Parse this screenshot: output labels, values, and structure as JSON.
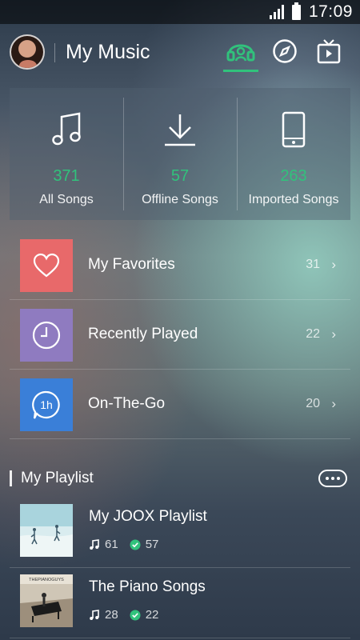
{
  "status_bar": {
    "time": "17:09",
    "signal_icon": "signal-icon",
    "battery_icon": "battery-icon"
  },
  "header": {
    "title": "My Music",
    "avatar": "avatar",
    "tabs": [
      {
        "icon": "headphones-icon",
        "active": true
      },
      {
        "icon": "compass-icon",
        "active": false
      },
      {
        "icon": "tv-icon",
        "active": false
      }
    ],
    "accent_color": "#31c27c"
  },
  "stats": [
    {
      "icon": "music-note-icon",
      "count": "371",
      "label": "All Songs"
    },
    {
      "icon": "download-icon",
      "count": "57",
      "label": "Offline Songs"
    },
    {
      "icon": "phone-icon",
      "count": "263",
      "label": "Imported Songs"
    }
  ],
  "lists": [
    {
      "icon": "heart-icon",
      "label": "My Favorites",
      "count": "31",
      "color": "#e8696a"
    },
    {
      "icon": "clock-icon",
      "label": "Recently Played",
      "count": "22",
      "color": "#8f7bc0"
    },
    {
      "icon": "one-hour-icon",
      "label": "On-The-Go",
      "count": "20",
      "color": "#3a7fd8"
    }
  ],
  "playlist_section": {
    "title": "My Playlist"
  },
  "playlists": [
    {
      "name": "My JOOX Playlist",
      "songs": "61",
      "offline": "57"
    },
    {
      "name": "The Piano Songs",
      "songs": "28",
      "offline": "22"
    }
  ]
}
